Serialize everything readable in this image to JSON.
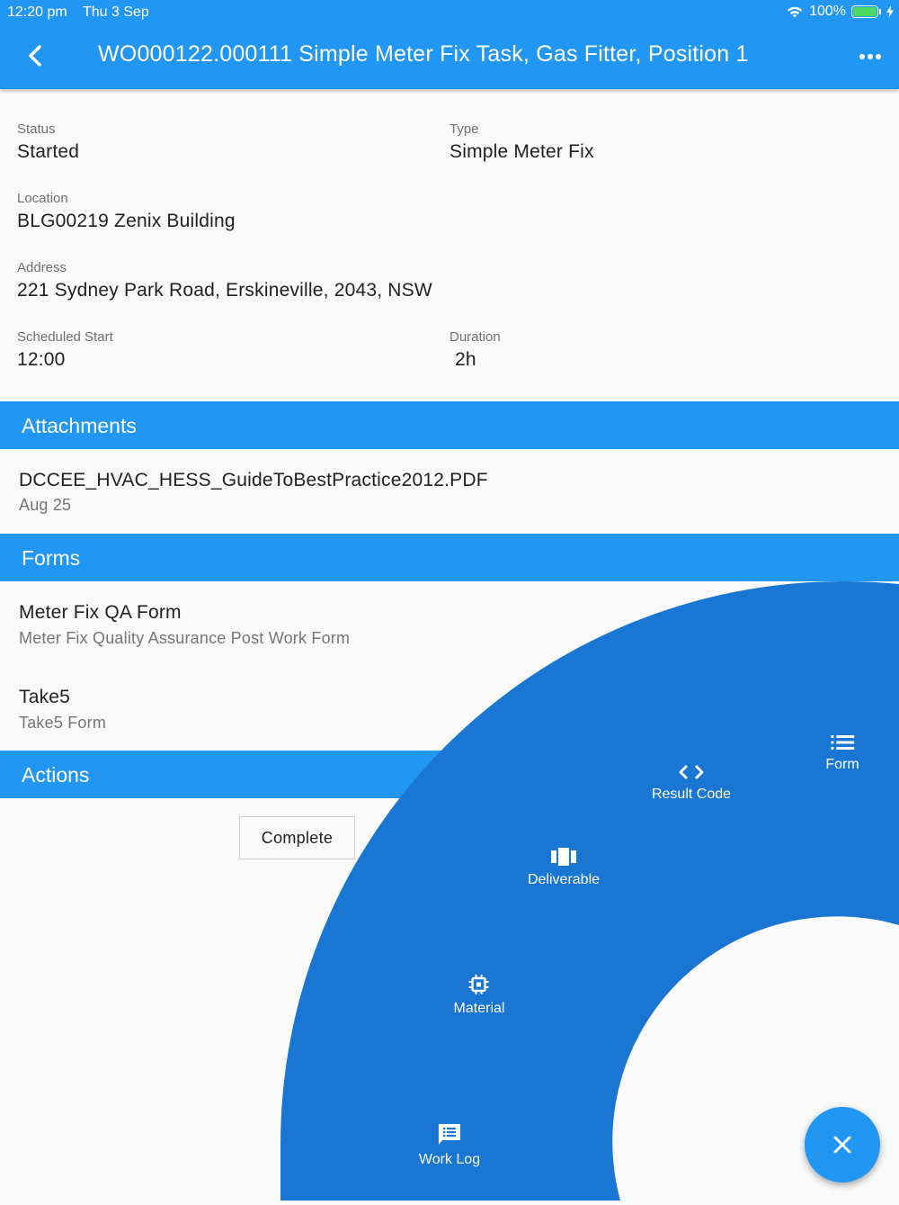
{
  "status_bar": {
    "time": "12:20 pm",
    "date": "Thu 3 Sep",
    "battery_text": "100%",
    "battery_level": 1.0
  },
  "header": {
    "title": "WO000122.000111 Simple Meter Fix Task, Gas Fitter, Position 1",
    "back_icon": "chevron-left-icon",
    "more_icon": "more-horizontal-icon"
  },
  "details": {
    "status_label": "Status",
    "status_value": "Started",
    "type_label": "Type",
    "type_value": "Simple Meter Fix",
    "location_label": "Location",
    "location_value": "BLG00219 Zenix Building",
    "address_label": "Address",
    "address_value": "221 Sydney Park Road, Erskineville, 2043, NSW",
    "start_label": "Scheduled Start",
    "start_value": "12:00",
    "duration_label": "Duration",
    "duration_value": "2h"
  },
  "attachments": {
    "header": "Attachments",
    "items": [
      {
        "name": "DCCEE_HVAC_HESS_GuideToBestPractice2012.PDF",
        "date": "Aug 25"
      }
    ]
  },
  "forms": {
    "header": "Forms",
    "items": [
      {
        "title": "Meter Fix QA Form",
        "subtitle": "Meter Fix Quality Assurance Post Work Form"
      },
      {
        "title": "Take5",
        "subtitle": "Take5 Form"
      }
    ]
  },
  "actions": {
    "header": "Actions",
    "complete_label": "Complete"
  },
  "radial_menu": {
    "items": [
      {
        "label": "Form",
        "icon": "list-icon"
      },
      {
        "label": "Result Code",
        "icon": "code-icon"
      },
      {
        "label": "Deliverable",
        "icon": "view-column-icon"
      },
      {
        "label": "Material",
        "icon": "chip-icon"
      },
      {
        "label": "Work Log",
        "icon": "message-list-icon"
      }
    ]
  },
  "fab": {
    "icon": "close-icon"
  },
  "colors": {
    "primary": "#2196f3",
    "radial": "#1976d2",
    "background": "#fafafa"
  }
}
